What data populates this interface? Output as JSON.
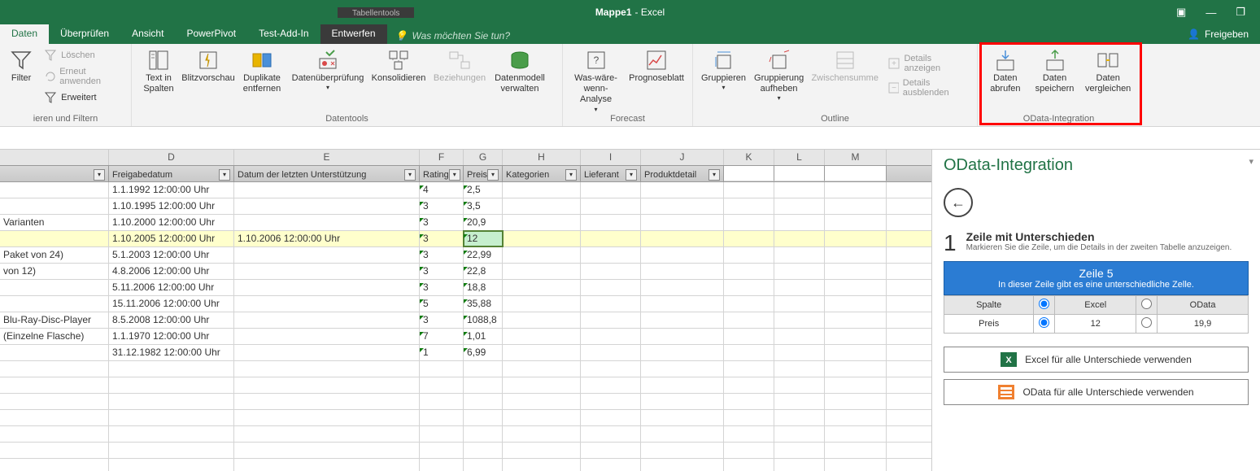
{
  "title": {
    "tabtools": "Tabellentools",
    "doc": "Mappe1",
    "app": "- Excel"
  },
  "menu": {
    "tabs": [
      "Daten",
      "Überprüfen",
      "Ansicht",
      "PowerPivot",
      "Test-Add-In",
      "Entwerfen"
    ],
    "tellme": "Was möchten Sie tun?",
    "share": "Freigeben"
  },
  "ribbon": {
    "filter": "Filter",
    "clear": "Löschen",
    "reapply": "Erneut anwenden",
    "advanced": "Erweitert",
    "group_filter": "ieren und Filtern",
    "textcols": "Text in Spalten",
    "flash": "Blitzvorschau",
    "dup": "Duplikate entfernen",
    "dataval": "Datenüberprüfung",
    "consol": "Konsolidieren",
    "rel": "Beziehungen",
    "model": "Datenmodell verwalten",
    "group_tools": "Datentools",
    "whatif": "Was-wäre-wenn-Analyse",
    "forecast": "Prognoseblatt",
    "group_forecast": "Forecast",
    "grp": "Gruppieren",
    "ungrp": "Gruppierung aufheben",
    "subt": "Zwischensumme",
    "showdet": "Details anzeigen",
    "hidedet": "Details ausblenden",
    "group_outline": "Outline",
    "odget": "Daten abrufen",
    "odsave": "Daten speichern",
    "odcmp": "Daten vergleichen",
    "group_odata": "OData-Integration"
  },
  "cols": {
    "letters": [
      "D",
      "E",
      "F",
      "G",
      "H",
      "I",
      "J",
      "K",
      "L",
      "M"
    ],
    "widths": [
      154,
      228,
      54,
      48,
      96,
      74,
      62,
      102,
      62,
      62,
      62,
      62,
      76
    ],
    "headers": [
      "",
      "Freigabedatum",
      "Datum der letzten Unterstützung",
      "Rating",
      "Preis",
      "Kategorien",
      "Lieferant",
      "Produktdetail"
    ]
  },
  "rows": [
    {
      "a": "",
      "b": "1.1.1992 12:00:00 Uhr",
      "c": "",
      "d": "4",
      "e": "2,5"
    },
    {
      "a": "",
      "b": "1.10.1995 12:00:00 Uhr",
      "c": "",
      "d": "3",
      "e": "3,5"
    },
    {
      "a": "Varianten",
      "b": "1.10.2000 12:00:00 Uhr",
      "c": "",
      "d": "3",
      "e": "20,9"
    },
    {
      "a": "",
      "b": "1.10.2005 12:00:00 Uhr",
      "c": "1.10.2006 12:00:00 Uhr",
      "d": "3",
      "e": "12",
      "hl": true,
      "grn": true
    },
    {
      "a": "Paket von 24)",
      "b": "5.1.2003 12:00:00 Uhr",
      "c": "",
      "d": "3",
      "e": "22,99"
    },
    {
      "a": "von 12)",
      "b": "4.8.2006 12:00:00 Uhr",
      "c": "",
      "d": "3",
      "e": "22,8"
    },
    {
      "a": "",
      "b": "5.11.2006 12:00:00 Uhr",
      "c": "",
      "d": "3",
      "e": "18,8"
    },
    {
      "a": "",
      "b": "15.11.2006 12:00:00 Uhr",
      "c": "",
      "d": "5",
      "e": "35,88"
    },
    {
      "a": "Blu-Ray-Disc-Player",
      "b": "8.5.2008 12:00:00 Uhr",
      "c": "",
      "d": "3",
      "e": "1088,8"
    },
    {
      "a": "(Einzelne Flasche)",
      "b": "1.1.1970 12:00:00 Uhr",
      "c": "",
      "d": "7",
      "e": "1,01"
    },
    {
      "a": "",
      "b": "31.12.1982 12:00:00 Uhr",
      "c": "",
      "d": "1",
      "e": "6,99"
    }
  ],
  "panel": {
    "title": "OData-Integration",
    "diffcount": "1",
    "difftitle": "Zeile mit Unterschieden",
    "diffsub": "Markieren Sie die Zeile, um die Details in der zweiten Tabelle anzuzeigen.",
    "bluetitle": "Zeile 5",
    "bluesub": "In dieser Zeile gibt es eine unterschiedliche Zelle.",
    "th_col": "Spalte",
    "th_excel": "Excel",
    "th_odata": "OData",
    "row_col": "Preis",
    "row_excel": "12",
    "row_odata": "19,9",
    "btn_excel": "Excel für alle Unterschiede verwenden",
    "btn_odata": "OData für alle Unterschiede verwenden"
  }
}
